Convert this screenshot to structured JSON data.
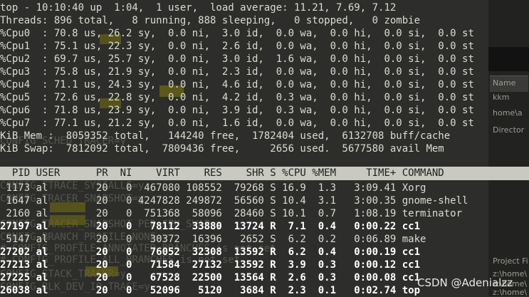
{
  "summary": {
    "uptime": "top - 10:10:40 up  1:04,  1 user,  load average: 11.21, 7.69, 7.12",
    "threads": "Threads: 896 total,   8 running, 888 sleeping,   0 stopped,   0 zombie"
  },
  "cpus": [
    "%Cpu0  : 70.8 us, 26.2 sy,  0.0 ni,  3.0 id,  0.0 wa,  0.0 hi,  0.0 si,  0.0 st",
    "%Cpu1  : 75.1 us, 22.3 sy,  0.0 ni,  2.6 id,  0.0 wa,  0.0 hi,  0.0 si,  0.0 st",
    "%Cpu2  : 69.7 us, 25.7 sy,  0.0 ni,  3.0 id,  1.6 wa,  0.0 hi,  0.0 si,  0.0 st",
    "%Cpu3  : 75.8 us, 21.9 sy,  0.0 ni,  2.3 id,  0.0 wa,  0.0 hi,  0.0 si,  0.0 st",
    "%Cpu4  : 71.1 us, 24.3 sy,  0.0 ni,  4.6 id,  0.0 wa,  0.0 hi,  0.0 si,  0.0 st",
    "%Cpu5  : 72.6 us, 22.8 sy,  0.0 ni,  4.2 id,  0.3 wa,  0.0 hi,  0.0 si,  0.0 st",
    "%Cpu6  : 71.8 us, 23.9 sy,  0.0 ni,  3.9 id,  0.3 wa,  0.0 hi,  0.0 si,  0.0 st",
    "%Cpu7  : 77.1 us, 21.2 sy,  0.0 ni,  1.6 id,  0.0 wa,  0.0 hi,  0.0 si,  0.0 st"
  ],
  "memory": {
    "mem": "KiB Mem :  8059352 total,   144240 free,  1782404 used,  6132708 buff/cache",
    "swap": "KiB Swap:  7812092 total,  7809436 free,     2656 used.  5677580 avail Mem"
  },
  "table": {
    "header": "  PID USER      PR  NI    VIRT    RES    SHR S %CPU %MEM     TIME+ COMMAND",
    "rows": [
      {
        "text": " 1173 al        20   0  467080 108552  79268 S 16.9  1.3   3:09.41 Xorg",
        "bold": false
      },
      {
        "text": " 1647 al        20   0 4247828 249872  56560 S 10.4  3.1   3:00.35 gnome-shell",
        "bold": false
      },
      {
        "text": " 2160 al        20   0  751368  58096  28460 S 10.1  0.7   1:08.19 terminator",
        "bold": false
      },
      {
        "text": "27197 al        20   0   78112  33880  13724 R  7.1  0.4   0:00.22 cc1",
        "bold": true
      },
      {
        "text": " 5147 al        20   0   30372  16396   2652 S  6.2  0.2   0:06.89 make",
        "bold": false
      },
      {
        "text": "27202 al        20   0   76052  32308  13592 R  6.2  0.4   0:00.19 cc1",
        "bold": true
      },
      {
        "text": "27213 al        20   0   71584  27132  13592 R  3.9  0.3   0:00.12 cc1",
        "bold": true
      },
      {
        "text": "27225 al        20   0   67528  22500  13564 R  2.6  0.3   0:00.08 cc1",
        "bold": true
      },
      {
        "text": "26038 al        20   0   52096   5120   3684 R  2.3  0.1   0:02.74 top",
        "bold": true
      }
    ]
  },
  "background": {
    "lines": [
      "CONFIG_SCHED_TRACER=y",
      "CONFIG_FTRACE_SYSCALLS=y",
      "CONFIG_TRACER_SNAPSHOT=y",
      "CONFIG_TRACER_SNAPSHOT_PER_CPU_SWAP=y",
      "CONFIG_BRANCH_PROFILE_NONE=y",
      "# CONFIG_PROFILE_ANNOTATED_BRANCHES is not set",
      "# CONFIG_PROFILE_ALL_BRANCHES is not set",
      "CONFIG_STACK_TRACER=y",
      "CONFIG_BLK_DEV_IO_TRACE=y"
    ],
    "side_panel": [
      "Name",
      "kkm",
      "home\\a",
      "Director",
      "Project Fi",
      "z:\\home\\",
      "z:\\home\\",
      "z:\\home\\"
    ]
  },
  "watermark": "CSDN @Adenialzz"
}
